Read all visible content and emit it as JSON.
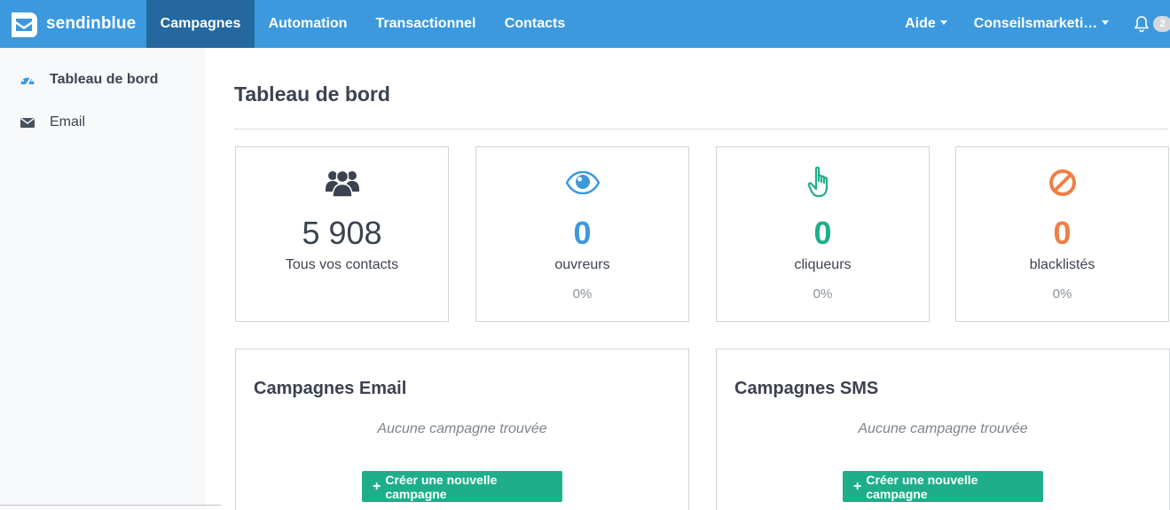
{
  "brand": {
    "name": "sendinblue"
  },
  "nav": {
    "items": [
      {
        "label": "Campagnes",
        "active": true
      },
      {
        "label": "Automation"
      },
      {
        "label": "Transactionnel"
      },
      {
        "label": "Contacts"
      }
    ],
    "help_label": "Aide",
    "account_label": "Conseilsmarketi…",
    "notification_count": "2"
  },
  "sidebar": {
    "items": [
      {
        "label": "Tableau de bord",
        "icon": "dashboard-icon"
      },
      {
        "label": "Email",
        "icon": "envelope-icon"
      }
    ]
  },
  "page": {
    "title": "Tableau de bord"
  },
  "stats": [
    {
      "value": "5 908",
      "label": "Tous vos contacts",
      "icon": "users-icon",
      "color": "#3b4250"
    },
    {
      "value": "0",
      "label": "ouvreurs",
      "pct": "0%",
      "icon": "eye-icon",
      "color": "#3c99de"
    },
    {
      "value": "0",
      "label": "cliqueurs",
      "pct": "0%",
      "icon": "pointer-hand-icon",
      "color": "#1eae8a"
    },
    {
      "value": "0",
      "label": "blacklistés",
      "pct": "0%",
      "icon": "ban-icon",
      "color": "#ef7f45"
    }
  ],
  "campaigns": {
    "email": {
      "title": "Campagnes Email",
      "empty": "Aucune campagne trouvée",
      "button": "Créer une nouvelle campagne"
    },
    "sms": {
      "title": "Campagnes SMS",
      "empty": "Aucune campagne trouvée",
      "button": "Créer une nouvelle campagne"
    }
  }
}
